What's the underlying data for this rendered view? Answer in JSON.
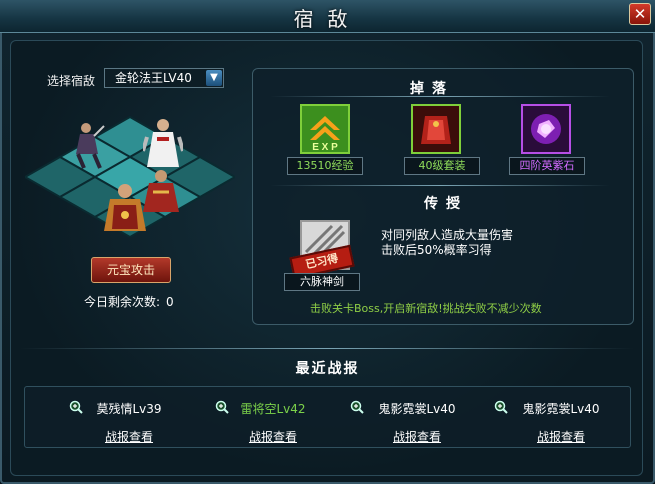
{
  "window": {
    "title": "宿敌",
    "close_label": "✕"
  },
  "selector": {
    "label": "选择宿敌",
    "value": "金轮法王LV40"
  },
  "attack": {
    "button_label": "元宝攻击",
    "remaining_label": "今日剩余次数:",
    "remaining_value": "0"
  },
  "drops": {
    "title": "掉落",
    "items": [
      {
        "label": "13510经验",
        "icon": "exp-icon",
        "label_color": "#8fdc5a"
      },
      {
        "label": "40级套装",
        "icon": "armor-set-icon",
        "label_color": "#8fdc5a"
      },
      {
        "label": "四阶英紫石",
        "icon": "purple-gem-icon",
        "label_color": "#d36cff"
      }
    ]
  },
  "teach": {
    "title": "传授",
    "skill_name": "六脉神剑",
    "stamp_text": "已习得",
    "desc_line1": "对同列敌人造成大量伤害",
    "desc_line2": "击败后50%概率习得"
  },
  "hint": "击败关卡Boss,开启新宿敌!挑战失败不减少次数",
  "battles": {
    "title": "最近战报",
    "entries": [
      {
        "name": "莫残情Lv39",
        "link": "战报查看",
        "name_color": "#ffffff"
      },
      {
        "name": "雷将空Lv42",
        "link": "战报查看",
        "name_color": "#7cd24a"
      },
      {
        "name": "鬼影霓裳Lv40",
        "link": "战报查看",
        "name_color": "#ffffff"
      },
      {
        "name": "鬼影霓裳Lv40",
        "link": "战报查看",
        "name_color": "#ffffff"
      }
    ]
  }
}
